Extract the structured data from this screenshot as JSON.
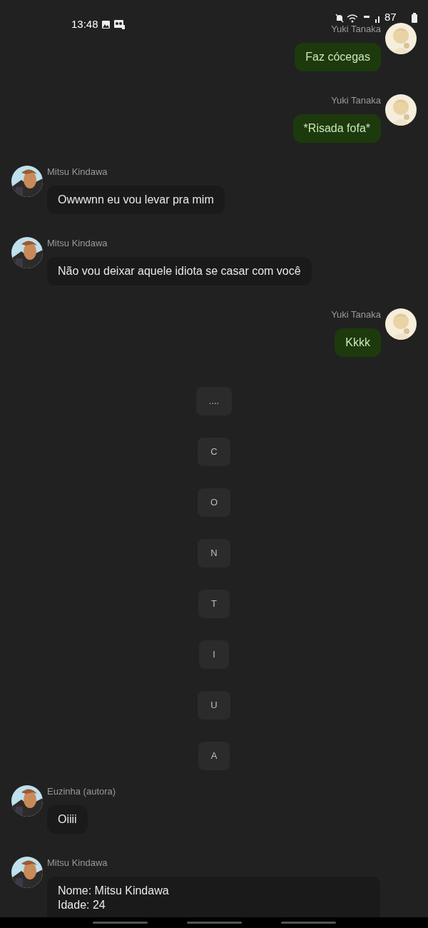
{
  "status_bar": {
    "time": "13:48",
    "battery": "87"
  },
  "messages": [
    {
      "kind": "sent",
      "sender": "Yuki Tanaka",
      "lines": [
        "Faz cócegas"
      ]
    },
    {
      "kind": "sent",
      "sender": "Yuki Tanaka",
      "lines": [
        "*Risada fofa*"
      ]
    },
    {
      "kind": "received",
      "sender": "Mitsu Kindawa",
      "lines": [
        "Owwwnn eu vou levar pra mim"
      ]
    },
    {
      "kind": "received",
      "sender": "Mitsu Kindawa",
      "lines": [
        "Não vou deixar aquele idiota se casar com você"
      ]
    },
    {
      "kind": "sent",
      "sender": "Yuki Tanaka",
      "lines": [
        "Kkkk"
      ]
    },
    {
      "kind": "system",
      "lines": [
        "...."
      ]
    },
    {
      "kind": "system",
      "lines": [
        "C"
      ]
    },
    {
      "kind": "system",
      "lines": [
        "O"
      ]
    },
    {
      "kind": "system",
      "lines": [
        "N"
      ]
    },
    {
      "kind": "system",
      "lines": [
        "T"
      ]
    },
    {
      "kind": "system",
      "lines": [
        "I"
      ]
    },
    {
      "kind": "system",
      "lines": [
        "U"
      ]
    },
    {
      "kind": "system",
      "lines": [
        "A"
      ]
    },
    {
      "kind": "received",
      "sender": "Euzinha (autora)",
      "lines": [
        "Oiiii"
      ]
    },
    {
      "kind": "received",
      "sender": "Mitsu Kindawa",
      "lines": [
        "Nome: Mitsu Kindawa",
        "Idade: 24"
      ],
      "cut": true
    }
  ]
}
